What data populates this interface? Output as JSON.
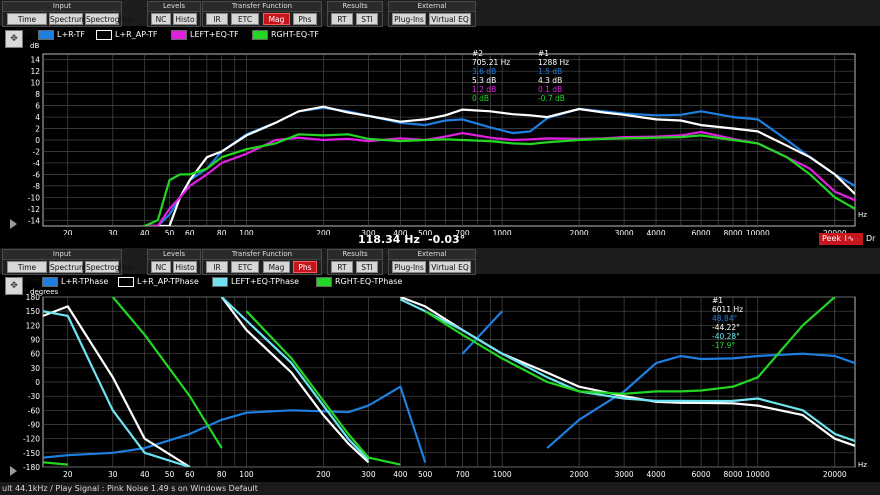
{
  "toolbar": {
    "groups": [
      {
        "title": "Input",
        "buttons": [
          {
            "label": "Time Signal"
          },
          {
            "label": "Spectrum"
          },
          {
            "label": "Spectrogram"
          }
        ]
      },
      {
        "title": "Levels",
        "buttons": [
          {
            "label": "NC"
          },
          {
            "label": "Histo"
          }
        ]
      },
      {
        "title": "Transfer Function",
        "buttons": [
          {
            "label": "IR"
          },
          {
            "label": "ETC"
          },
          {
            "label": "Mag"
          },
          {
            "label": "Phs"
          }
        ]
      },
      {
        "title": "Results",
        "buttons": [
          {
            "label": "RT"
          },
          {
            "label": "STI"
          }
        ]
      },
      {
        "title": "External",
        "buttons": [
          {
            "label": "Plug-Ins"
          },
          {
            "label": "Virtual EQ"
          }
        ]
      }
    ],
    "top_active": "Mag",
    "bottom_active": "Phs"
  },
  "mag": {
    "legend": [
      {
        "label": "L+R-TF",
        "color": "#1e7fe0"
      },
      {
        "label": "L+R_AP-TF",
        "color": "#ffffff"
      },
      {
        "label": "LEFT+EQ-TF",
        "color": "#e020e0"
      },
      {
        "label": "RGHT-EQ-TF",
        "color": "#22d622"
      }
    ],
    "unit": "dB",
    "xunit": "Hz",
    "cursor2": {
      "label": "#2",
      "freq": "705.21 Hz",
      "values": [
        "3.6 dB",
        "5.3 dB",
        "1.2 dB",
        "0 dB"
      ]
    },
    "cursor1": {
      "label": "#1",
      "freq": "1288 Hz",
      "values": [
        "1.5 dB",
        "4.3 dB",
        "0.1 dB",
        "-0.7 dB"
      ]
    },
    "readout": {
      "freq": "118.34 Hz",
      "value": "-0.03°"
    },
    "peek": "Peek",
    "right_cut": "Dr"
  },
  "phase": {
    "legend": [
      {
        "label": "L+R-TPhase",
        "color": "#1e7fe0"
      },
      {
        "label": "L+R_AP-TPhase",
        "color": "#ffffff"
      },
      {
        "label": "LEFT+EQ-TPhase",
        "color": "#6fe4f0"
      },
      {
        "label": "RGHT-EQ-TPhase",
        "color": "#22d622"
      }
    ],
    "unit": "degrees",
    "xunit": "Hz",
    "cursor1": {
      "label": "#1",
      "freq": "6011 Hz",
      "values": [
        "48.84°",
        "-44.22°",
        "-40.28°",
        "-17.9°"
      ]
    }
  },
  "status": "ult 44.1kHz / Play Signal : Pink Noise  1.49 s on Windows Default",
  "chart_data": [
    {
      "type": "line",
      "title": "",
      "ylabel": "dB",
      "xlabel": "Hz",
      "xscale": "log",
      "xlim": [
        16,
        24000
      ],
      "ylim": [
        -15,
        15
      ],
      "yticks": [
        14,
        12,
        10,
        8,
        6,
        4,
        2,
        0,
        -2,
        -4,
        -6,
        -8,
        -10,
        -12,
        -14
      ],
      "xticks": [
        "20",
        "30",
        "40",
        "50",
        "60",
        "80",
        "100",
        "200",
        "300",
        "400",
        "500",
        "700",
        "1000",
        "2000",
        "3000",
        "4000",
        "6000",
        "8000",
        "10000",
        "20000"
      ],
      "grid": true,
      "legend": "top-left",
      "series": [
        {
          "name": "L+R-TF",
          "color": "#1e7fe0",
          "x": [
            40,
            45,
            50,
            55,
            60,
            70,
            80,
            100,
            130,
            160,
            200,
            250,
            300,
            400,
            500,
            600,
            700,
            900,
            1100,
            1288,
            1500,
            2000,
            2500,
            3000,
            4000,
            5000,
            6000,
            8000,
            10000,
            13000,
            16000,
            20000,
            24000
          ],
          "y": [
            -20,
            -16,
            -13,
            -10,
            -7,
            -5,
            -2,
            1,
            3,
            5,
            5.6,
            5,
            4.2,
            3,
            2.6,
            3.4,
            3.6,
            2.2,
            1.2,
            1.5,
            3.8,
            5.4,
            5,
            4.6,
            4.3,
            4.4,
            5,
            4,
            3.6,
            0,
            -3,
            -6,
            -8
          ]
        },
        {
          "name": "L+R_AP-TF",
          "color": "#ffffff",
          "x": [
            40,
            45,
            50,
            55,
            60,
            70,
            80,
            100,
            130,
            160,
            200,
            250,
            300,
            400,
            500,
            600,
            700,
            900,
            1100,
            1288,
            1500,
            2000,
            2500,
            3000,
            4000,
            5000,
            6000,
            8000,
            10000,
            13000,
            16000,
            20000,
            24000
          ],
          "y": [
            -20,
            -18,
            -15,
            -10,
            -7,
            -3,
            -2,
            0.8,
            3,
            5,
            5.8,
            4.8,
            4.2,
            3.2,
            3.6,
            4.3,
            5.3,
            5,
            4.5,
            4.3,
            4,
            5.4,
            4.8,
            4.4,
            3.6,
            3.4,
            2.6,
            2,
            1.5,
            -1,
            -3,
            -6,
            -9.4
          ]
        },
        {
          "name": "LEFT+EQ-TF",
          "color": "#e020e0",
          "x": [
            40,
            45,
            50,
            55,
            60,
            70,
            80,
            100,
            130,
            160,
            200,
            250,
            300,
            400,
            500,
            600,
            700,
            900,
            1100,
            1288,
            1500,
            2000,
            2500,
            3000,
            4000,
            5000,
            6000,
            8000,
            10000,
            13000,
            16000,
            20000,
            24000
          ],
          "y": [
            -20,
            -16,
            -12,
            -10,
            -8,
            -6,
            -4,
            -2.4,
            0,
            0.4,
            0,
            0.2,
            -0.2,
            0.3,
            0,
            0.6,
            1.2,
            0.4,
            0,
            0.1,
            0.3,
            0.2,
            0.3,
            0.5,
            0.6,
            0.8,
            1.4,
            0.2,
            -0.6,
            -3,
            -5,
            -9,
            -10.5
          ]
        },
        {
          "name": "RGHT-EQ-TF",
          "color": "#22d622",
          "x": [
            40,
            45,
            50,
            55,
            60,
            70,
            80,
            100,
            130,
            160,
            200,
            250,
            300,
            400,
            500,
            600,
            700,
            900,
            1100,
            1288,
            1500,
            2000,
            2500,
            3000,
            4000,
            5000,
            6000,
            8000,
            10000,
            13000,
            16000,
            20000,
            24000
          ],
          "y": [
            -20,
            -14,
            -7,
            -6,
            -6,
            -5,
            -3,
            -1.6,
            -0.6,
            1,
            0.8,
            1,
            0.2,
            -0.2,
            0,
            0.1,
            0,
            -0.2,
            -0.6,
            -0.7,
            -0.4,
            0,
            0.2,
            0.3,
            0.4,
            0.5,
            0.8,
            0,
            -0.6,
            -3,
            -6,
            -10,
            -12
          ]
        }
      ]
    },
    {
      "type": "line",
      "title": "",
      "ylabel": "degrees",
      "xlabel": "Hz",
      "xscale": "log",
      "xlim": [
        16,
        24000
      ],
      "ylim": [
        -180,
        180
      ],
      "yticks": [
        180,
        150,
        120,
        90,
        60,
        30,
        0,
        -30,
        -60,
        -90,
        -120,
        -150,
        -180
      ],
      "xticks": [
        "20",
        "30",
        "40",
        "50",
        "60",
        "80",
        "100",
        "200",
        "300",
        "400",
        "500",
        "700",
        "1000",
        "2000",
        "3000",
        "4000",
        "6000",
        "8000",
        "10000",
        "20000"
      ],
      "grid": true,
      "legend": "top-left",
      "series": [
        {
          "name": "L+R-TPhase",
          "color": "#1e7fe0",
          "x": [
            16,
            20,
            30,
            40,
            60,
            80,
            100,
            150,
            200,
            250,
            300,
            400,
            500,
            700,
            1000,
            1500,
            2000,
            3000,
            4000,
            5000,
            6011,
            8000,
            10000,
            15000,
            20000,
            24000
          ],
          "y": [
            -160,
            -155,
            -150,
            -140,
            -110,
            -80,
            -65,
            -60,
            -62,
            -64,
            -50,
            -10,
            -170,
            60,
            150,
            -140,
            -80,
            -20,
            40,
            55,
            48.8,
            50,
            55,
            60,
            55,
            40
          ]
        },
        {
          "name": "L+R_AP-TPhase",
          "color": "#ffffff",
          "x": [
            16,
            20,
            30,
            40,
            60,
            80,
            100,
            150,
            200,
            250,
            300,
            400,
            500,
            700,
            1000,
            1500,
            2000,
            3000,
            4000,
            5000,
            6011,
            8000,
            10000,
            15000,
            20000,
            24000
          ],
          "y": [
            140,
            160,
            10,
            -120,
            -180,
            180,
            110,
            20,
            -70,
            -130,
            -170,
            180,
            160,
            110,
            60,
            20,
            -10,
            -30,
            -42,
            -44,
            -44.2,
            -45,
            -50,
            -70,
            -120,
            -135
          ]
        },
        {
          "name": "LEFT+EQ-TPhase",
          "color": "#6fe4f0",
          "x": [
            16,
            20,
            30,
            40,
            60,
            80,
            100,
            150,
            200,
            250,
            300,
            400,
            500,
            700,
            1000,
            1500,
            2000,
            3000,
            4000,
            5000,
            6011,
            8000,
            10000,
            15000,
            20000,
            24000
          ],
          "y": [
            150,
            140,
            -60,
            -150,
            -180,
            180,
            130,
            40,
            -50,
            -120,
            -165,
            175,
            150,
            110,
            60,
            10,
            -20,
            -35,
            -40,
            -40,
            -40.3,
            -40,
            -35,
            -60,
            -110,
            -125
          ]
        },
        {
          "name": "RGHT-EQ-TPhase",
          "color": "#22d622",
          "x": [
            16,
            20,
            30,
            40,
            60,
            80,
            100,
            150,
            200,
            250,
            300,
            400,
            500,
            700,
            1000,
            1500,
            2000,
            3000,
            4000,
            5000,
            6011,
            8000,
            10000,
            15000,
            20000,
            24000
          ],
          "y": [
            -170,
            -175,
            180,
            100,
            -30,
            -140,
            150,
            50,
            -40,
            -110,
            -160,
            -175,
            150,
            100,
            50,
            0,
            -20,
            -25,
            -20,
            -20,
            -17.9,
            -10,
            10,
            120,
            180,
            -170
          ]
        }
      ]
    }
  ]
}
